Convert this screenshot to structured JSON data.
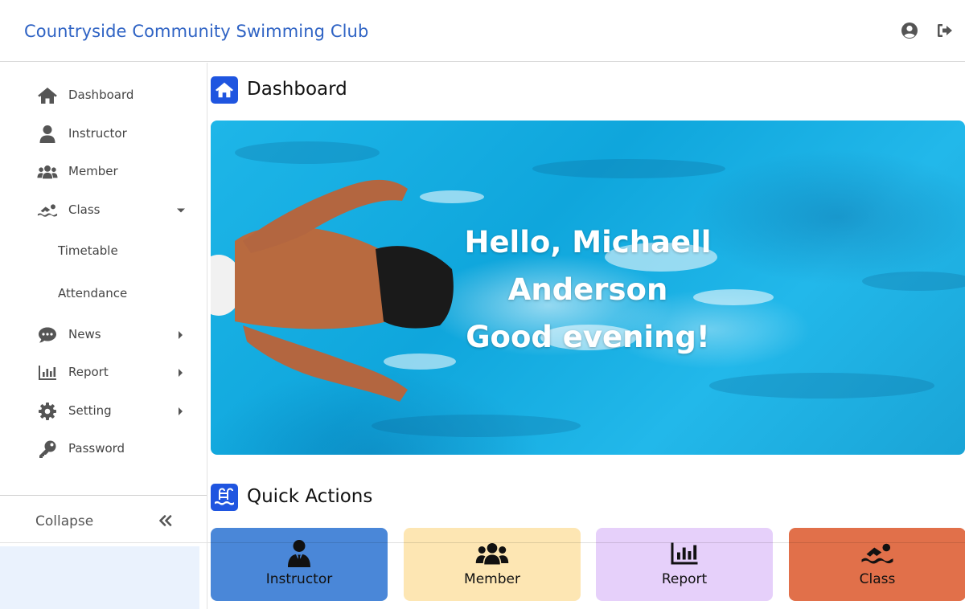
{
  "app": {
    "title": "Countryside Community Swimming Club",
    "brand_color": "#2f63c4"
  },
  "header": {
    "icons": [
      "user-circle-icon",
      "sign-out-icon"
    ]
  },
  "sidebar": {
    "items": [
      {
        "label": "Dashboard",
        "icon": "home-icon"
      },
      {
        "label": "Instructor",
        "icon": "user-icon"
      },
      {
        "label": "Member",
        "icon": "users-icon"
      },
      {
        "label": "Class",
        "icon": "swimmer-icon",
        "expanded": true,
        "children": [
          {
            "label": "Timetable"
          },
          {
            "label": "Attendance"
          }
        ]
      },
      {
        "label": "News",
        "icon": "chat-icon"
      },
      {
        "label": "Report",
        "icon": "bar-chart-icon"
      },
      {
        "label": "Setting",
        "icon": "gear-icon"
      },
      {
        "label": "Password",
        "icon": "key-icon"
      }
    ],
    "collapse_label": "Collapse"
  },
  "main": {
    "dashboard_title": "Dashboard",
    "hero": {
      "line1": "Hello, Michaell",
      "line2": "Anderson",
      "line3": "Good evening!"
    },
    "quick_actions_title": "Quick Actions",
    "quick_actions": [
      {
        "label": "Instructor",
        "icon": "user-tie-icon",
        "color": "#4a87d8"
      },
      {
        "label": "Member",
        "icon": "users-icon",
        "color": "#fde6b3"
      },
      {
        "label": "Report",
        "icon": "bar-chart-icon",
        "color": "#e6d0fa"
      },
      {
        "label": "Class",
        "icon": "swimmer-icon",
        "color": "#e1704a"
      }
    ]
  }
}
